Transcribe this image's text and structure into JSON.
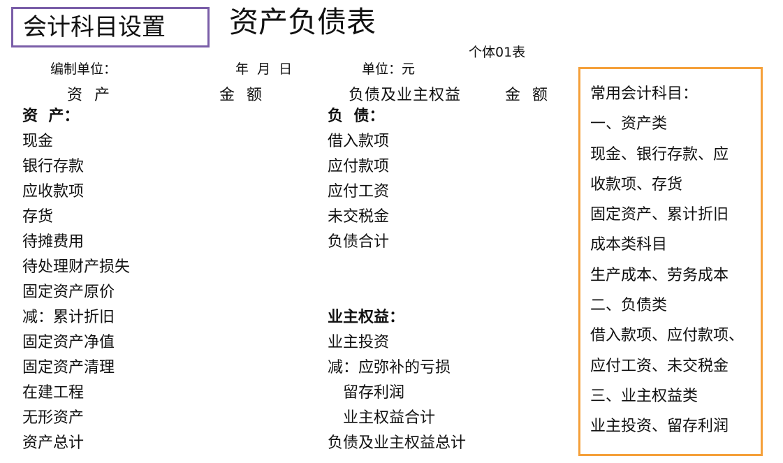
{
  "header": {
    "subject_setup_button": "会计科目设置",
    "title": "资产负债表",
    "form_id": "个体01表",
    "prepared_by_label": "编制单位：",
    "date_label": "年  月  日",
    "unit_label": "单位：元"
  },
  "columns": {
    "assets": "资  产",
    "amount_left": "金  额",
    "liabilities_equity": "负债及业主权益",
    "amount_right": "金  额"
  },
  "assets": {
    "section": "资  产：",
    "items": [
      "现金",
      "银行存款",
      "应收款项",
      "存货",
      "待摊费用",
      "待处理财产损失",
      "固定资产原价",
      "减：累计折旧",
      "固定资产净值",
      "固定资产清理",
      "在建工程",
      "无形资产",
      "资产总计"
    ]
  },
  "liabilities": {
    "section": "负  债：",
    "items": [
      "借入款项",
      "应付款项",
      "应付工资",
      "未交税金",
      "负债合计"
    ]
  },
  "equity": {
    "section": "业主权益：",
    "items": [
      "业主投资",
      "减：应弥补的亏损",
      "留存利润",
      "业主权益合计"
    ],
    "total": "负债及业主权益总计"
  },
  "common_subjects": {
    "title": "常用会计科目：",
    "lines": [
      "一、资产类",
      "现金、银行存款、应",
      "收款项、存货",
      "固定资产、累计折旧",
      "成本类科目",
      "生产成本、劳务成本",
      "二、负债类",
      "借入款项、应付款项、",
      "应付工资、未交税金",
      "三、业主权益类",
      "业主投资、留存利润"
    ]
  },
  "colors": {
    "button_border": "#7a5ea8",
    "box_border": "#f5a03a"
  }
}
